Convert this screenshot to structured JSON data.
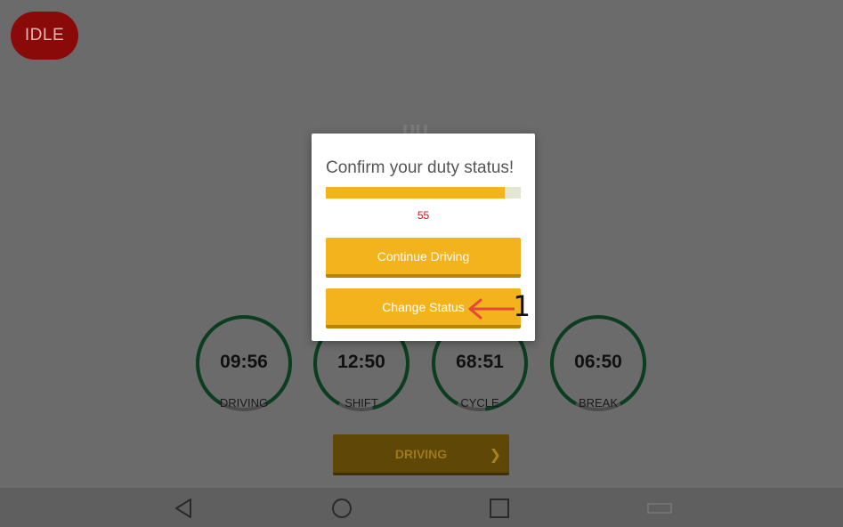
{
  "status_badge": "IDLE",
  "gauges": [
    {
      "value": "09:56",
      "label": "DRIVING",
      "progress": 0.84
    },
    {
      "value": "12:50",
      "label": "SHIFT",
      "progress": 0.88
    },
    {
      "value": "68:51",
      "label": "CYCLE",
      "progress": 0.9
    },
    {
      "value": "06:50",
      "label": "BREAK",
      "progress": 0.84
    }
  ],
  "driving_button": {
    "label": "DRIVING",
    "chevron_icon": "chevron-right-icon"
  },
  "dialog": {
    "title": "Confirm your duty status!",
    "progress": 0.92,
    "countdown": "55",
    "continue_label": "Continue Driving",
    "change_label": "Change Status"
  },
  "annotation": {
    "number": "1"
  },
  "navbar": {
    "icons": [
      "back-icon",
      "home-icon",
      "recents-icon"
    ]
  },
  "colors": {
    "accent": "#f2b31d",
    "badge": "#8a0a0a",
    "countdown": "#c4161c",
    "gauge_arc": "#0b3d1f"
  }
}
